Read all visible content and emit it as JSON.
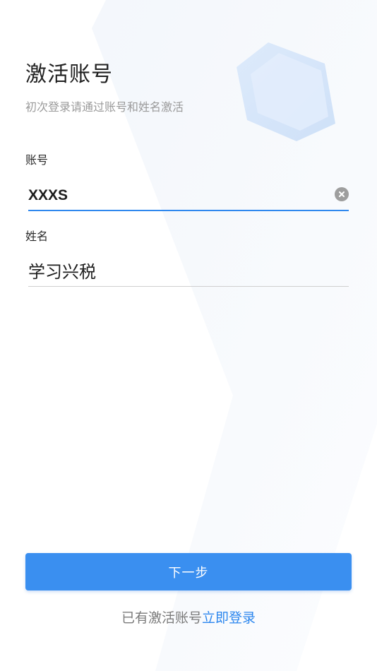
{
  "header": {
    "title": "激活账号",
    "subtitle": "初次登录请通过账号和姓名激活"
  },
  "form": {
    "account": {
      "label": "账号",
      "value": "XXXS"
    },
    "name": {
      "label": "姓名",
      "value": "学习兴税"
    }
  },
  "actions": {
    "next_label": "下一步"
  },
  "footer": {
    "prefix": "已有激活账号",
    "login_link": "立即登录"
  },
  "colors": {
    "accent": "#3a8ff0",
    "link": "#2b86ee",
    "active_underline": "#2f88ee"
  },
  "icons": {
    "clear": "clear-icon",
    "decor": "hexagon-decor-icon"
  }
}
